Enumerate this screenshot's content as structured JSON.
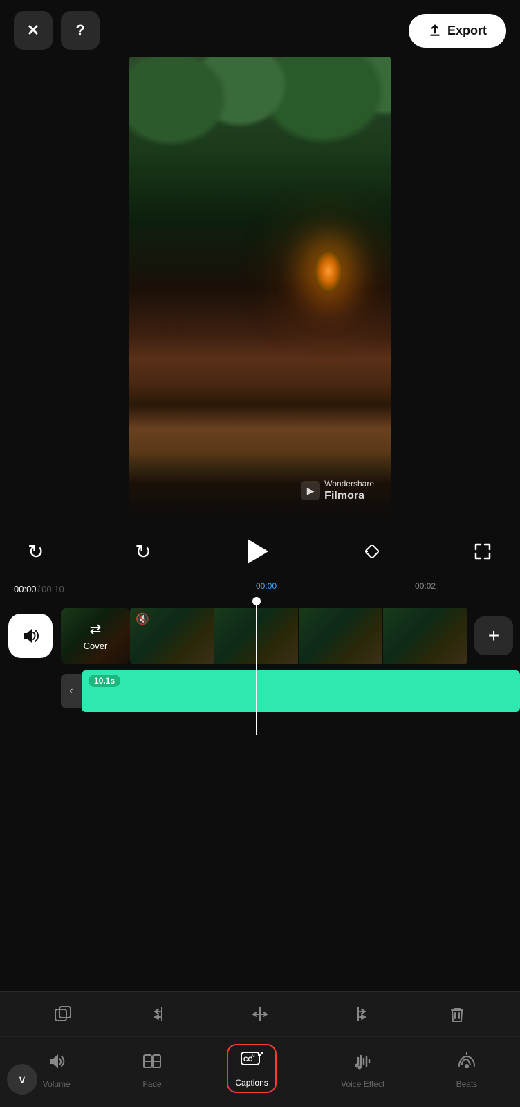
{
  "topBar": {
    "closeLabel": "✕",
    "helpLabel": "?",
    "exportLabel": "Export"
  },
  "video": {
    "watermark": {
      "brand": "Filmora",
      "brandPrefix": "Wondershare"
    }
  },
  "playback": {
    "currentTime": "00:00",
    "totalTime": "00:10",
    "separator": "/"
  },
  "timeline": {
    "marks": [
      "00:00",
      "00:02"
    ],
    "playheadTime": "00:00"
  },
  "tracks": {
    "volumeIcon": "🔊",
    "coverLabel": "Cover",
    "muteIcon": "🔇",
    "addIcon": "+",
    "captionDuration": "10.1s",
    "collapseIcon": "‹"
  },
  "bottomToolbar": {
    "icons": [
      "⊕",
      ":C",
      "C:",
      ":C:",
      "🗑"
    ],
    "navItems": [
      {
        "label": "Volume",
        "icon": "🔊",
        "active": false
      },
      {
        "label": "Fade",
        "icon": "▥",
        "active": false
      },
      {
        "label": "Captions",
        "icon": "CC",
        "active": true
      },
      {
        "label": "Voice Effect",
        "icon": "🎙",
        "active": false
      },
      {
        "label": "Beats",
        "icon": "🎵",
        "active": false
      }
    ],
    "downIcon": "∨"
  }
}
